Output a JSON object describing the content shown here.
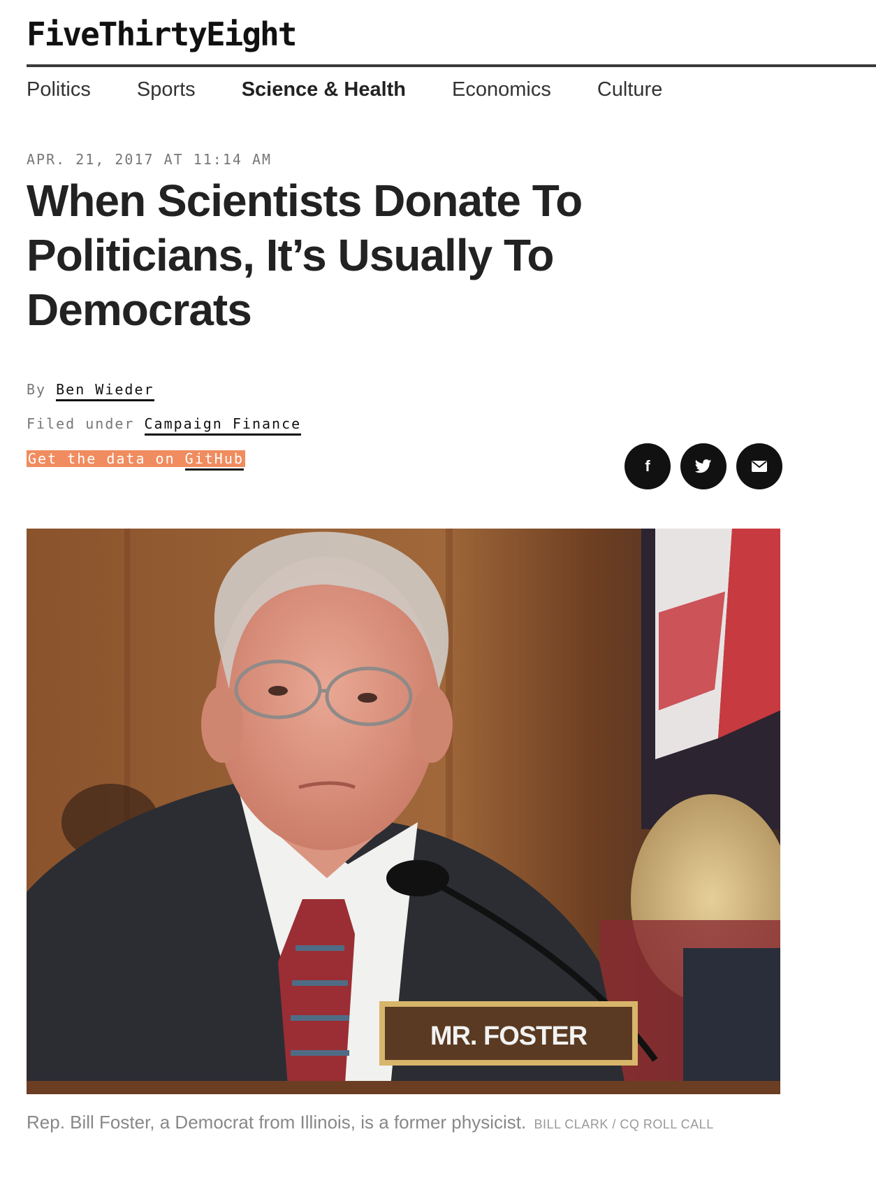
{
  "site": {
    "logo": "FiveThirtyEight"
  },
  "nav": {
    "items": [
      {
        "label": "Politics"
      },
      {
        "label": "Sports"
      },
      {
        "label": "Science & Health"
      },
      {
        "label": "Economics"
      },
      {
        "label": "Culture"
      }
    ],
    "active": "Science & Health"
  },
  "article": {
    "dateline": "APR. 21, 2017 AT 11:14 AM",
    "headline": "When Scientists Donate To Politicians, It’s Usually To Democrats",
    "byline_prefix": "By",
    "author": "Ben Wieder",
    "filed_prefix": "Filed under",
    "category": "Campaign Finance",
    "github_prefix": "Get the data on",
    "github_link": "GitHub"
  },
  "share": {
    "icons": [
      "facebook-icon",
      "twitter-icon",
      "email-icon"
    ],
    "facebook_glyph": "f"
  },
  "photo": {
    "nameplate": "MR. FOSTER"
  },
  "caption": {
    "text": "Rep. Bill Foster, a Democrat from Illinois, is a former physicist.",
    "credit": "BILL CLARK / CQ ROLL CALL"
  },
  "colors": {
    "accent_orange": "#f08c5f",
    "text_dark": "#222222",
    "text_muted": "#777777"
  }
}
